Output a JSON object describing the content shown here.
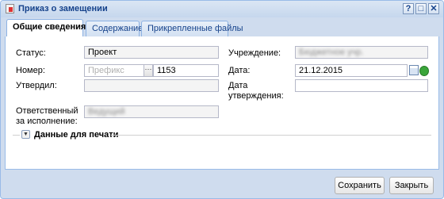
{
  "window": {
    "title": "Приказ о замещении",
    "help_glyph": "?",
    "maximize_glyph": "□",
    "close_glyph": "✕"
  },
  "tabs": [
    {
      "label": "Общие сведения",
      "active": true
    },
    {
      "label": "Содержание",
      "active": false
    },
    {
      "label": "Прикрепленные файлы",
      "active": false
    }
  ],
  "form": {
    "status_label": "Статус:",
    "status_value": "Проект",
    "number_label": "Номер:",
    "number_prefix_placeholder": "Префикс",
    "number_lookup_glyph": "···",
    "number_value": "1153",
    "approved_by_label": "Утвердил:",
    "approved_by_value": "",
    "responsible_label_line1": "Ответственный",
    "responsible_label_line2": "за исполнение:",
    "responsible_value": "Ведущий",
    "institution_label": "Учреждение:",
    "institution_value": "Бюджетное учр.",
    "date_label": "Дата:",
    "date_value": "21.12.2015",
    "approval_date_label_line1": "Дата",
    "approval_date_label_line2": "утверждения:",
    "approval_date_value": ""
  },
  "print_section": {
    "expand_glyph": "▼",
    "label": "Данные для печати"
  },
  "buttons": {
    "save_label": "Сохранить",
    "close_label": "Закрыть"
  },
  "colors": {
    "title_text": "#15428b",
    "window_border": "#99bbe8",
    "window_bg": "#cfdcee"
  }
}
